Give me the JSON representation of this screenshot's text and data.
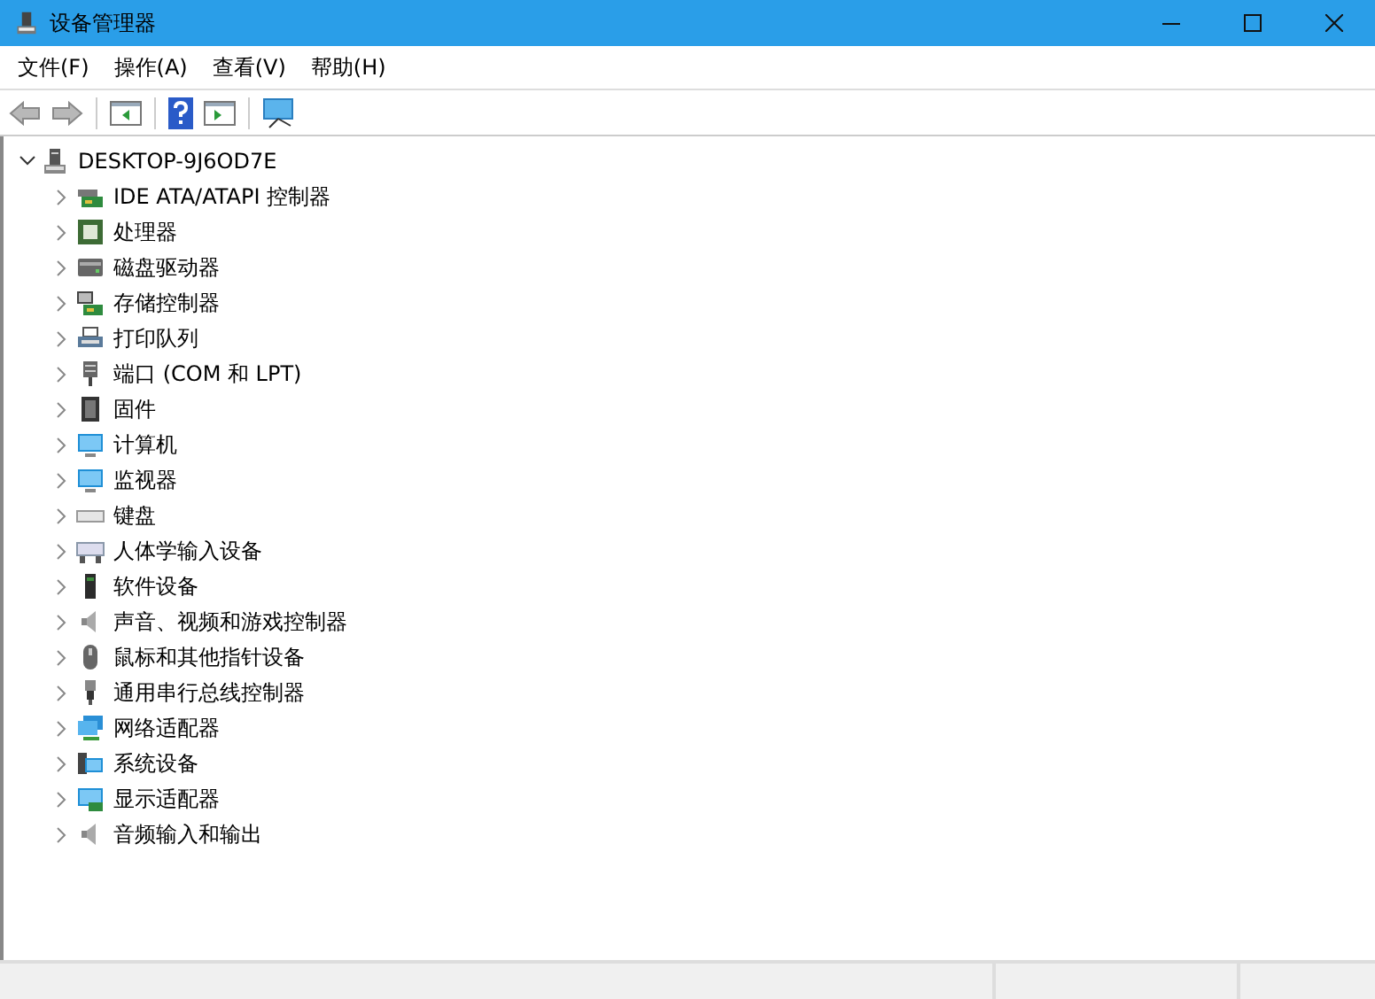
{
  "window": {
    "title": "设备管理器"
  },
  "menu": [
    "文件(F)",
    "操作(A)",
    "查看(V)",
    "帮助(H)"
  ],
  "toolbar": {
    "back_disabled": true,
    "forward_disabled": true
  },
  "tree": {
    "label": "DESKTOP-9J6OD7E",
    "expanded": true,
    "children": [
      {
        "label": "IDE ATA/ATAPI 控制器",
        "expanded": false
      },
      {
        "label": "处理器",
        "expanded": false
      },
      {
        "label": "磁盘驱动器",
        "expanded": false
      },
      {
        "label": "存储控制器",
        "expanded": false
      },
      {
        "label": "打印队列",
        "expanded": false
      },
      {
        "label": "端口 (COM 和 LPT)",
        "expanded": false
      },
      {
        "label": "固件",
        "expanded": false
      },
      {
        "label": "计算机",
        "expanded": false
      },
      {
        "label": "监视器",
        "expanded": false
      },
      {
        "label": "键盘",
        "expanded": false
      },
      {
        "label": "人体学输入设备",
        "expanded": false
      },
      {
        "label": "软件设备",
        "expanded": false
      },
      {
        "label": "声音、视频和游戏控制器",
        "expanded": false
      },
      {
        "label": "鼠标和其他指针设备",
        "expanded": false
      },
      {
        "label": "通用串行总线控制器",
        "expanded": false
      },
      {
        "label": "网络适配器",
        "expanded": false
      },
      {
        "label": "系统设备",
        "expanded": false
      },
      {
        "label": "显示适配器",
        "expanded": false
      },
      {
        "label": "音频输入和输出",
        "expanded": false
      }
    ]
  }
}
